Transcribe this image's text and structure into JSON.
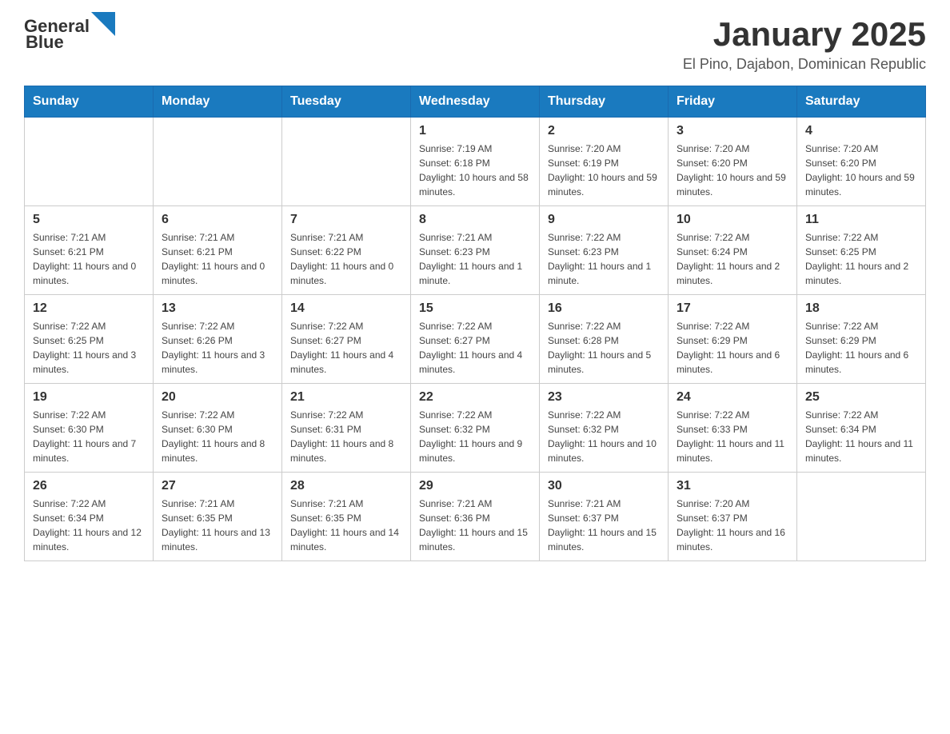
{
  "header": {
    "logo_general": "General",
    "logo_blue": "Blue",
    "month_year": "January 2025",
    "location": "El Pino, Dajabon, Dominican Republic"
  },
  "days_of_week": [
    "Sunday",
    "Monday",
    "Tuesday",
    "Wednesday",
    "Thursday",
    "Friday",
    "Saturday"
  ],
  "weeks": [
    [
      {
        "num": "",
        "info": ""
      },
      {
        "num": "",
        "info": ""
      },
      {
        "num": "",
        "info": ""
      },
      {
        "num": "1",
        "info": "Sunrise: 7:19 AM\nSunset: 6:18 PM\nDaylight: 10 hours and 58 minutes."
      },
      {
        "num": "2",
        "info": "Sunrise: 7:20 AM\nSunset: 6:19 PM\nDaylight: 10 hours and 59 minutes."
      },
      {
        "num": "3",
        "info": "Sunrise: 7:20 AM\nSunset: 6:20 PM\nDaylight: 10 hours and 59 minutes."
      },
      {
        "num": "4",
        "info": "Sunrise: 7:20 AM\nSunset: 6:20 PM\nDaylight: 10 hours and 59 minutes."
      }
    ],
    [
      {
        "num": "5",
        "info": "Sunrise: 7:21 AM\nSunset: 6:21 PM\nDaylight: 11 hours and 0 minutes."
      },
      {
        "num": "6",
        "info": "Sunrise: 7:21 AM\nSunset: 6:21 PM\nDaylight: 11 hours and 0 minutes."
      },
      {
        "num": "7",
        "info": "Sunrise: 7:21 AM\nSunset: 6:22 PM\nDaylight: 11 hours and 0 minutes."
      },
      {
        "num": "8",
        "info": "Sunrise: 7:21 AM\nSunset: 6:23 PM\nDaylight: 11 hours and 1 minute."
      },
      {
        "num": "9",
        "info": "Sunrise: 7:22 AM\nSunset: 6:23 PM\nDaylight: 11 hours and 1 minute."
      },
      {
        "num": "10",
        "info": "Sunrise: 7:22 AM\nSunset: 6:24 PM\nDaylight: 11 hours and 2 minutes."
      },
      {
        "num": "11",
        "info": "Sunrise: 7:22 AM\nSunset: 6:25 PM\nDaylight: 11 hours and 2 minutes."
      }
    ],
    [
      {
        "num": "12",
        "info": "Sunrise: 7:22 AM\nSunset: 6:25 PM\nDaylight: 11 hours and 3 minutes."
      },
      {
        "num": "13",
        "info": "Sunrise: 7:22 AM\nSunset: 6:26 PM\nDaylight: 11 hours and 3 minutes."
      },
      {
        "num": "14",
        "info": "Sunrise: 7:22 AM\nSunset: 6:27 PM\nDaylight: 11 hours and 4 minutes."
      },
      {
        "num": "15",
        "info": "Sunrise: 7:22 AM\nSunset: 6:27 PM\nDaylight: 11 hours and 4 minutes."
      },
      {
        "num": "16",
        "info": "Sunrise: 7:22 AM\nSunset: 6:28 PM\nDaylight: 11 hours and 5 minutes."
      },
      {
        "num": "17",
        "info": "Sunrise: 7:22 AM\nSunset: 6:29 PM\nDaylight: 11 hours and 6 minutes."
      },
      {
        "num": "18",
        "info": "Sunrise: 7:22 AM\nSunset: 6:29 PM\nDaylight: 11 hours and 6 minutes."
      }
    ],
    [
      {
        "num": "19",
        "info": "Sunrise: 7:22 AM\nSunset: 6:30 PM\nDaylight: 11 hours and 7 minutes."
      },
      {
        "num": "20",
        "info": "Sunrise: 7:22 AM\nSunset: 6:30 PM\nDaylight: 11 hours and 8 minutes."
      },
      {
        "num": "21",
        "info": "Sunrise: 7:22 AM\nSunset: 6:31 PM\nDaylight: 11 hours and 8 minutes."
      },
      {
        "num": "22",
        "info": "Sunrise: 7:22 AM\nSunset: 6:32 PM\nDaylight: 11 hours and 9 minutes."
      },
      {
        "num": "23",
        "info": "Sunrise: 7:22 AM\nSunset: 6:32 PM\nDaylight: 11 hours and 10 minutes."
      },
      {
        "num": "24",
        "info": "Sunrise: 7:22 AM\nSunset: 6:33 PM\nDaylight: 11 hours and 11 minutes."
      },
      {
        "num": "25",
        "info": "Sunrise: 7:22 AM\nSunset: 6:34 PM\nDaylight: 11 hours and 11 minutes."
      }
    ],
    [
      {
        "num": "26",
        "info": "Sunrise: 7:22 AM\nSunset: 6:34 PM\nDaylight: 11 hours and 12 minutes."
      },
      {
        "num": "27",
        "info": "Sunrise: 7:21 AM\nSunset: 6:35 PM\nDaylight: 11 hours and 13 minutes."
      },
      {
        "num": "28",
        "info": "Sunrise: 7:21 AM\nSunset: 6:35 PM\nDaylight: 11 hours and 14 minutes."
      },
      {
        "num": "29",
        "info": "Sunrise: 7:21 AM\nSunset: 6:36 PM\nDaylight: 11 hours and 15 minutes."
      },
      {
        "num": "30",
        "info": "Sunrise: 7:21 AM\nSunset: 6:37 PM\nDaylight: 11 hours and 15 minutes."
      },
      {
        "num": "31",
        "info": "Sunrise: 7:20 AM\nSunset: 6:37 PM\nDaylight: 11 hours and 16 minutes."
      },
      {
        "num": "",
        "info": ""
      }
    ]
  ]
}
